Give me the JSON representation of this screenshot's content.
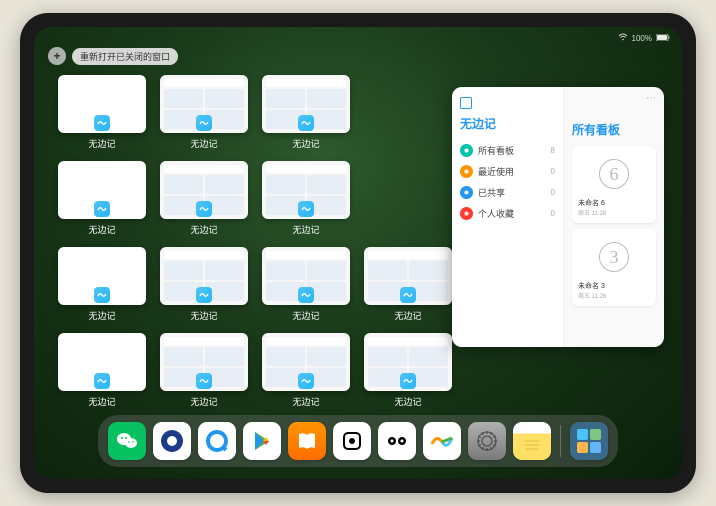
{
  "status": {
    "battery": "100%"
  },
  "top": {
    "plus": "+",
    "reopen_label": "重新打开已关闭的窗口"
  },
  "windows": {
    "app_label": "无边记"
  },
  "panel": {
    "left_title": "无边记",
    "right_title": "所有看板",
    "items": [
      {
        "label": "所有看板",
        "count": "8",
        "color": "#00c4a7"
      },
      {
        "label": "最近使用",
        "count": "0",
        "color": "#ff9500"
      },
      {
        "label": "已共享",
        "count": "0",
        "color": "#2196f3"
      },
      {
        "label": "个人收藏",
        "count": "0",
        "color": "#ff3b30"
      }
    ],
    "boards": [
      {
        "name": "未命名 6",
        "date": "周五 11:28",
        "num": "6"
      },
      {
        "name": "未命名 3",
        "date": "周五 11:26",
        "num": "3"
      }
    ]
  },
  "dock": {
    "apps": [
      {
        "name": "wechat",
        "bg": "#07c160",
        "glyph": "💬"
      },
      {
        "name": "tencent-video",
        "bg": "#ffffff",
        "glyph": "●"
      },
      {
        "name": "browser-q",
        "bg": "#ffffff",
        "glyph": "Q"
      },
      {
        "name": "play-store",
        "bg": "#ffffff",
        "glyph": "▶"
      },
      {
        "name": "books",
        "bg": "#ff9500",
        "glyph": "▮▮"
      },
      {
        "name": "dice",
        "bg": "#ffffff",
        "glyph": "⚀"
      },
      {
        "name": "connect",
        "bg": "#ffffff",
        "glyph": "⦿⦿"
      },
      {
        "name": "freeform",
        "bg": "#ffffff",
        "glyph": "〰"
      },
      {
        "name": "settings",
        "bg": "#8e8e93",
        "glyph": "⚙"
      },
      {
        "name": "notes",
        "bg": "#ffe066",
        "glyph": ""
      }
    ],
    "recent": {
      "name": "recent-apps",
      "bg": "#3a6a8a"
    }
  }
}
